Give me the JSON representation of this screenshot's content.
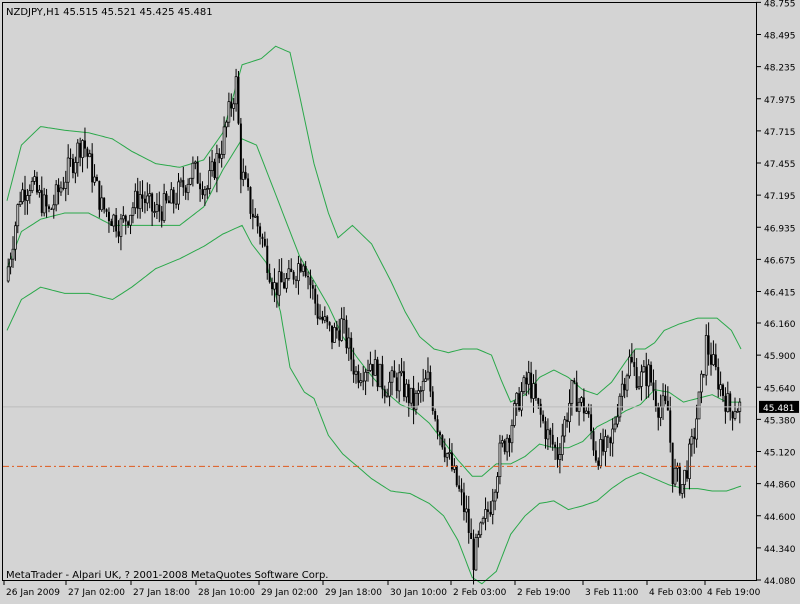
{
  "window": {
    "symbol_header": "NZDJPY,H1  45.515 45.521 45.425 45.481",
    "copyright": "MetaTrader - Alpari UK, ? 2001-2008 MetaQuotes Software Corp."
  },
  "colors": {
    "background": "#d4d4d4",
    "candle": "#000000",
    "bands": "#2aa84a",
    "level_line": "#e05a1e",
    "price_tag_bg": "#000000",
    "price_tag_text": "#ffffff",
    "border": "#000000",
    "grid": "#b8b8b8"
  },
  "chart_data": {
    "type": "candlestick",
    "symbol": "NZDJPY",
    "timeframe": "H1",
    "last_price": "45.481",
    "ohlc": {
      "open": 45.515,
      "high": 45.521,
      "low": 45.425,
      "close": 45.481
    },
    "ylim": [
      44.08,
      48.75
    ],
    "y_ticks": [
      "48.755",
      "48.495",
      "48.235",
      "47.975",
      "47.715",
      "47.455",
      "47.195",
      "46.935",
      "46.675",
      "46.415",
      "46.160",
      "45.900",
      "45.640",
      "45.380",
      "45.120",
      "44.860",
      "44.600",
      "44.340",
      "44.080"
    ],
    "x_ticks": [
      "26 Jan 2009",
      "27 Jan 02:00",
      "27 Jan 18:00",
      "28 Jan 10:00",
      "29 Jan 02:00",
      "29 Jan 18:00",
      "30 Jan 10:00",
      "2 Feb 03:00",
      "2 Feb 19:00",
      "3 Feb 11:00",
      "4 Feb 03:00",
      "4 Feb 19:00"
    ],
    "horizontal_level": 45.0,
    "indicator": "Bollinger Bands",
    "close_path": [
      [
        0,
        46.5
      ],
      [
        6,
        47.2
      ],
      [
        10,
        47.3
      ],
      [
        18,
        47.05
      ],
      [
        25,
        47.35
      ],
      [
        32,
        47.65
      ],
      [
        40,
        47.1
      ],
      [
        48,
        46.95
      ],
      [
        56,
        47.2
      ],
      [
        62,
        47.05
      ],
      [
        70,
        47.15
      ],
      [
        78,
        47.4
      ],
      [
        84,
        47.25
      ],
      [
        90,
        47.6
      ],
      [
        96,
        48.1
      ],
      [
        98,
        47.4
      ],
      [
        102,
        47.1
      ],
      [
        106,
        46.9
      ],
      [
        112,
        46.45
      ],
      [
        118,
        46.5
      ],
      [
        124,
        46.7
      ],
      [
        130,
        46.25
      ],
      [
        136,
        46.05
      ],
      [
        140,
        46.15
      ],
      [
        146,
        45.75
      ],
      [
        152,
        45.85
      ],
      [
        158,
        45.65
      ],
      [
        164,
        45.7
      ],
      [
        170,
        45.5
      ],
      [
        176,
        45.7
      ],
      [
        180,
        45.35
      ],
      [
        184,
        45.1
      ],
      [
        188,
        44.85
      ],
      [
        192,
        44.6
      ],
      [
        195,
        44.25
      ],
      [
        198,
        44.45
      ],
      [
        202,
        44.7
      ],
      [
        206,
        45.1
      ],
      [
        210,
        45.3
      ],
      [
        214,
        45.55
      ],
      [
        218,
        45.7
      ],
      [
        222,
        45.45
      ],
      [
        226,
        45.25
      ],
      [
        230,
        45.1
      ],
      [
        236,
        45.6
      ],
      [
        242,
        45.45
      ],
      [
        246,
        45.1
      ],
      [
        252,
        45.15
      ],
      [
        256,
        45.6
      ],
      [
        260,
        45.85
      ],
      [
        264,
        45.7
      ],
      [
        268,
        45.75
      ],
      [
        272,
        45.5
      ],
      [
        276,
        45.45
      ],
      [
        278,
        44.95
      ],
      [
        282,
        44.85
      ],
      [
        286,
        45.15
      ],
      [
        290,
        45.65
      ],
      [
        292,
        46.0
      ],
      [
        296,
        45.75
      ],
      [
        300,
        45.55
      ],
      [
        302,
        45.45
      ],
      [
        304,
        45.5
      ],
      [
        306,
        45.48
      ]
    ],
    "bb_upper": [
      [
        0,
        47.15
      ],
      [
        6,
        47.6
      ],
      [
        14,
        47.75
      ],
      [
        24,
        47.72
      ],
      [
        34,
        47.7
      ],
      [
        44,
        47.65
      ],
      [
        52,
        47.55
      ],
      [
        62,
        47.45
      ],
      [
        72,
        47.42
      ],
      [
        82,
        47.48
      ],
      [
        90,
        47.7
      ],
      [
        98,
        48.25
      ],
      [
        106,
        48.3
      ],
      [
        112,
        48.4
      ],
      [
        118,
        48.35
      ],
      [
        122,
        48.0
      ],
      [
        128,
        47.45
      ],
      [
        134,
        47.05
      ],
      [
        138,
        46.85
      ],
      [
        144,
        46.95
      ],
      [
        152,
        46.8
      ],
      [
        160,
        46.5
      ],
      [
        166,
        46.25
      ],
      [
        172,
        46.05
      ],
      [
        178,
        45.95
      ],
      [
        184,
        45.92
      ],
      [
        190,
        45.95
      ],
      [
        196,
        45.95
      ],
      [
        202,
        45.9
      ],
      [
        206,
        45.7
      ],
      [
        210,
        45.52
      ],
      [
        216,
        45.58
      ],
      [
        222,
        45.72
      ],
      [
        228,
        45.78
      ],
      [
        234,
        45.72
      ],
      [
        240,
        45.62
      ],
      [
        246,
        45.58
      ],
      [
        252,
        45.68
      ],
      [
        258,
        45.85
      ],
      [
        262,
        45.95
      ],
      [
        266,
        45.95
      ],
      [
        270,
        46.0
      ],
      [
        274,
        46.1
      ],
      [
        280,
        46.15
      ],
      [
        288,
        46.2
      ],
      [
        296,
        46.2
      ],
      [
        302,
        46.1
      ],
      [
        306,
        45.95
      ]
    ],
    "bb_middle": [
      [
        0,
        46.6
      ],
      [
        6,
        46.9
      ],
      [
        14,
        47.0
      ],
      [
        24,
        47.05
      ],
      [
        34,
        47.05
      ],
      [
        44,
        46.95
      ],
      [
        52,
        46.95
      ],
      [
        62,
        46.95
      ],
      [
        72,
        46.95
      ],
      [
        82,
        47.1
      ],
      [
        90,
        47.4
      ],
      [
        98,
        47.65
      ],
      [
        104,
        47.6
      ],
      [
        110,
        47.3
      ],
      [
        116,
        47.0
      ],
      [
        122,
        46.7
      ],
      [
        128,
        46.5
      ],
      [
        134,
        46.3
      ],
      [
        140,
        46.05
      ],
      [
        146,
        45.88
      ],
      [
        152,
        45.73
      ],
      [
        158,
        45.6
      ],
      [
        164,
        45.5
      ],
      [
        170,
        45.45
      ],
      [
        176,
        45.35
      ],
      [
        182,
        45.2
      ],
      [
        188,
        45.05
      ],
      [
        194,
        44.92
      ],
      [
        198,
        44.92
      ],
      [
        204,
        45.02
      ],
      [
        210,
        45.02
      ],
      [
        216,
        45.08
      ],
      [
        222,
        45.18
      ],
      [
        228,
        45.15
      ],
      [
        234,
        45.15
      ],
      [
        240,
        45.2
      ],
      [
        246,
        45.32
      ],
      [
        252,
        45.38
      ],
      [
        258,
        45.45
      ],
      [
        264,
        45.5
      ],
      [
        270,
        45.62
      ],
      [
        276,
        45.6
      ],
      [
        282,
        45.52
      ],
      [
        288,
        45.55
      ],
      [
        294,
        45.58
      ],
      [
        300,
        45.52
      ],
      [
        306,
        45.52
      ]
    ],
    "bb_lower": [
      [
        0,
        46.1
      ],
      [
        6,
        46.35
      ],
      [
        14,
        46.45
      ],
      [
        24,
        46.4
      ],
      [
        34,
        46.4
      ],
      [
        44,
        46.35
      ],
      [
        52,
        46.45
      ],
      [
        62,
        46.6
      ],
      [
        72,
        46.68
      ],
      [
        82,
        46.78
      ],
      [
        90,
        46.88
      ],
      [
        98,
        46.95
      ],
      [
        102,
        46.8
      ],
      [
        108,
        46.65
      ],
      [
        114,
        46.25
      ],
      [
        118,
        45.8
      ],
      [
        124,
        45.6
      ],
      [
        128,
        45.55
      ],
      [
        134,
        45.25
      ],
      [
        140,
        45.1
      ],
      [
        146,
        45.0
      ],
      [
        152,
        44.9
      ],
      [
        160,
        44.8
      ],
      [
        168,
        44.78
      ],
      [
        176,
        44.7
      ],
      [
        182,
        44.6
      ],
      [
        188,
        44.4
      ],
      [
        194,
        44.1
      ],
      [
        198,
        44.05
      ],
      [
        204,
        44.15
      ],
      [
        210,
        44.45
      ],
      [
        216,
        44.6
      ],
      [
        222,
        44.7
      ],
      [
        228,
        44.72
      ],
      [
        234,
        44.65
      ],
      [
        240,
        44.68
      ],
      [
        246,
        44.72
      ],
      [
        252,
        44.82
      ],
      [
        258,
        44.9
      ],
      [
        264,
        44.95
      ],
      [
        270,
        44.9
      ],
      [
        276,
        44.85
      ],
      [
        282,
        44.82
      ],
      [
        288,
        44.82
      ],
      [
        294,
        44.8
      ],
      [
        300,
        44.8
      ],
      [
        306,
        44.84
      ]
    ]
  }
}
